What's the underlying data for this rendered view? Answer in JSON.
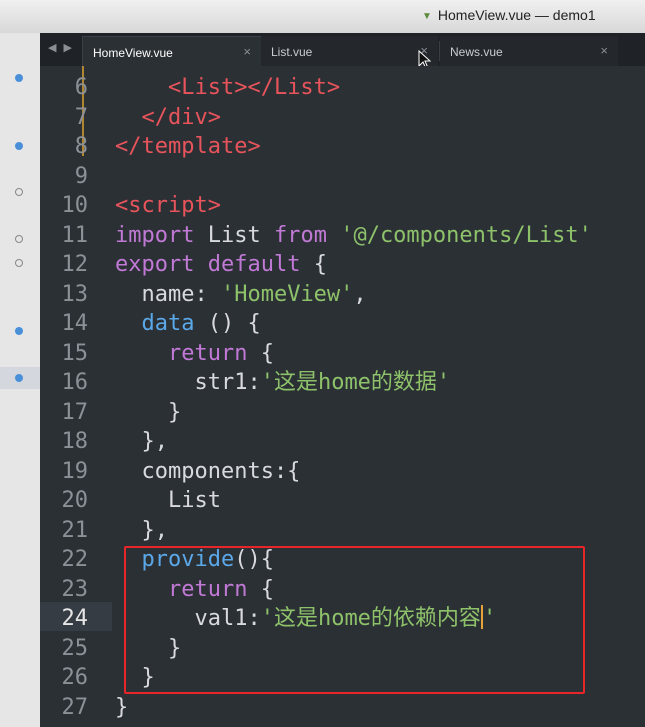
{
  "window": {
    "title": "HomeView.vue — demo1"
  },
  "tabs": [
    {
      "label": "HomeView.vue",
      "close": "×",
      "active": true
    },
    {
      "label": "List.vue",
      "close": "×",
      "active": false
    },
    {
      "label": "News.vue",
      "close": "×",
      "active": false
    }
  ],
  "nav_arrows": "◀ ▶",
  "editor": {
    "current_line": "24",
    "lines": [
      {
        "n": "6",
        "t": [
          [
            "",
            "    "
          ],
          [
            "tag",
            "<List></List>"
          ]
        ]
      },
      {
        "n": "7",
        "t": [
          [
            "",
            "  "
          ],
          [
            "tag",
            "</div>"
          ]
        ]
      },
      {
        "n": "8",
        "t": [
          [
            "tag",
            "</template>"
          ]
        ]
      },
      {
        "n": "9",
        "t": []
      },
      {
        "n": "10",
        "t": [
          [
            "tag",
            "<script>"
          ]
        ]
      },
      {
        "n": "11",
        "t": [
          [
            "kw",
            "import"
          ],
          [
            "",
            " List "
          ],
          [
            "kw",
            "from"
          ],
          [
            "",
            " "
          ],
          [
            "str",
            "'@/components/List'"
          ]
        ]
      },
      {
        "n": "12",
        "t": [
          [
            "kw",
            "export"
          ],
          [
            "",
            " "
          ],
          [
            "kw",
            "default"
          ],
          [
            "",
            " {"
          ]
        ]
      },
      {
        "n": "13",
        "t": [
          [
            "",
            "  name: "
          ],
          [
            "str",
            "'HomeView'"
          ],
          [
            "",
            ","
          ]
        ]
      },
      {
        "n": "14",
        "t": [
          [
            "",
            "  "
          ],
          [
            "fn",
            "data"
          ],
          [
            "",
            " () {"
          ]
        ]
      },
      {
        "n": "15",
        "t": [
          [
            "",
            "    "
          ],
          [
            "kw",
            "return"
          ],
          [
            "",
            " {"
          ]
        ]
      },
      {
        "n": "16",
        "t": [
          [
            "",
            "      str1:"
          ],
          [
            "str",
            "'这是home的数据'"
          ]
        ]
      },
      {
        "n": "17",
        "t": [
          [
            "",
            "    }"
          ]
        ]
      },
      {
        "n": "18",
        "t": [
          [
            "",
            "  },"
          ]
        ]
      },
      {
        "n": "19",
        "t": [
          [
            "",
            "  components:{"
          ]
        ]
      },
      {
        "n": "20",
        "t": [
          [
            "",
            "    List"
          ]
        ]
      },
      {
        "n": "21",
        "t": [
          [
            "",
            "  },"
          ]
        ]
      },
      {
        "n": "22",
        "t": [
          [
            "",
            "  "
          ],
          [
            "fn",
            "provide"
          ],
          [
            "",
            "(){"
          ]
        ]
      },
      {
        "n": "23",
        "t": [
          [
            "",
            "    "
          ],
          [
            "kw",
            "return"
          ],
          [
            "",
            " {"
          ]
        ]
      },
      {
        "n": "24",
        "t": [
          [
            "",
            "      val1:"
          ],
          [
            "str",
            "'这是home的依赖内容"
          ],
          [
            "caret",
            ""
          ],
          [
            "str",
            "'"
          ]
        ]
      },
      {
        "n": "25",
        "t": [
          [
            "",
            "    }"
          ]
        ]
      },
      {
        "n": "26",
        "t": [
          [
            "",
            "  }"
          ]
        ]
      },
      {
        "n": "27",
        "t": [
          [
            "",
            "}"
          ]
        ]
      }
    ]
  },
  "colors": {
    "tag": "#e8545b",
    "keyword": "#c179d6",
    "string": "#8ec26a",
    "function": "#5aa8e8",
    "highlight_box": "#e8262a"
  }
}
